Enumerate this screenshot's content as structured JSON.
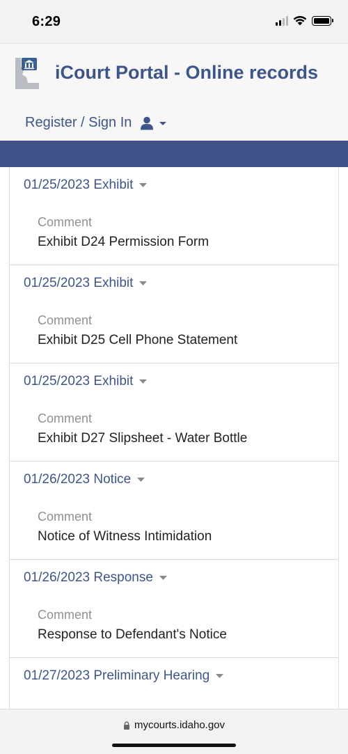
{
  "status_bar": {
    "time": "6:29"
  },
  "header": {
    "title": "iCourt Portal - Online records",
    "register_label": "Register / Sign In"
  },
  "entries": [
    {
      "heading": "01/25/2023 Exhibit",
      "comment_label": "Comment",
      "comment": "Exhibit D24 Permission Form"
    },
    {
      "heading": "01/25/2023 Exhibit",
      "comment_label": "Comment",
      "comment": "Exhibit D25 Cell Phone Statement"
    },
    {
      "heading": "01/25/2023 Exhibit",
      "comment_label": "Comment",
      "comment": "Exhibit D27 Slipsheet - Water Bottle"
    },
    {
      "heading": "01/26/2023 Notice",
      "comment_label": "Comment",
      "comment": "Notice of Witness Intimidation"
    },
    {
      "heading": "01/26/2023 Response",
      "comment_label": "Comment",
      "comment": "Response to Defendant's Notice"
    },
    {
      "heading": "01/27/2023 Preliminary Hearing",
      "comment_label": "",
      "comment": ""
    }
  ],
  "browser": {
    "url": "mycourts.idaho.gov"
  },
  "colors": {
    "brand": "#3e5589",
    "band": "#3f5389"
  },
  "icons": [
    "idaho-courthouse-logo-icon",
    "user-icon",
    "caret-down-icon",
    "lock-icon",
    "signal-icon",
    "wifi-icon",
    "battery-icon"
  ]
}
